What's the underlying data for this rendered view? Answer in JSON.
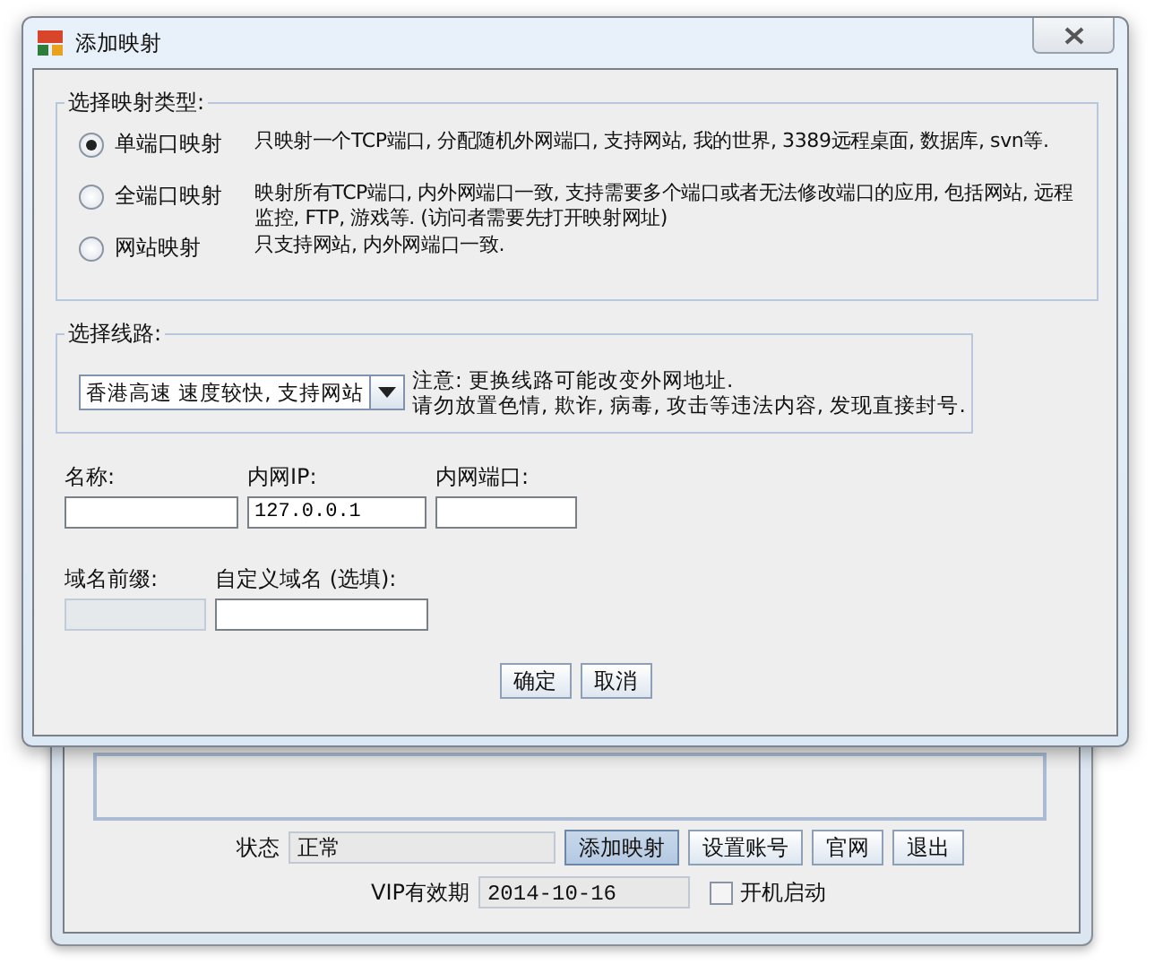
{
  "main_window": {
    "status_label": "状态",
    "status_value": "正常",
    "buttons": [
      {
        "label": "添加映射",
        "pressed": true
      },
      {
        "label": "设置账号",
        "pressed": false
      },
      {
        "label": "官网",
        "pressed": false
      },
      {
        "label": "退出",
        "pressed": false
      }
    ],
    "vip_label": "VIP有效期",
    "vip_value": "2014-10-16",
    "autostart": {
      "label": "开机启动",
      "checked": false
    }
  },
  "dialog": {
    "title": "添加映射",
    "type_group": {
      "title": "选择映射类型:",
      "options": [
        {
          "label": "单端口映射",
          "description": "只映射一个TCP端口, 分配随机外网端口, 支持网站, 我的世界, 3389远程桌面, 数据库, svn等.",
          "selected": true
        },
        {
          "label": "全端口映射",
          "description": "映射所有TCP端口, 内外网端口一致, 支持需要多个端口或者无法修改端口的应用, 包括网站, 远程监控, FTP, 游戏等. (访问者需要先打开映射网址)",
          "selected": false
        },
        {
          "label": "网站映射",
          "description": "只支持网站, 内外网端口一致.",
          "selected": false
        }
      ]
    },
    "route_group": {
      "title": "选择线路:",
      "route": "香港高速  速度较快, 支持网站",
      "notes": [
        "注意: 更换线路可能改变外网地址.",
        "请勿放置色情, 欺诈, 病毒, 攻击等违法内容, 发现直接封号."
      ]
    },
    "fields_row1": [
      {
        "label": "名称:",
        "disabled": false
      },
      {
        "label": "内网IP:",
        "value": "127.0.0.1",
        "disabled": false
      },
      {
        "label": "内网端口:",
        "disabled": false
      }
    ],
    "fields_row2": [
      {
        "label": "域名前缀:",
        "disabled": true
      },
      {
        "label": "自定义域名 (选填):",
        "disabled": false
      }
    ],
    "buttons": [
      "确定",
      "取消"
    ]
  }
}
